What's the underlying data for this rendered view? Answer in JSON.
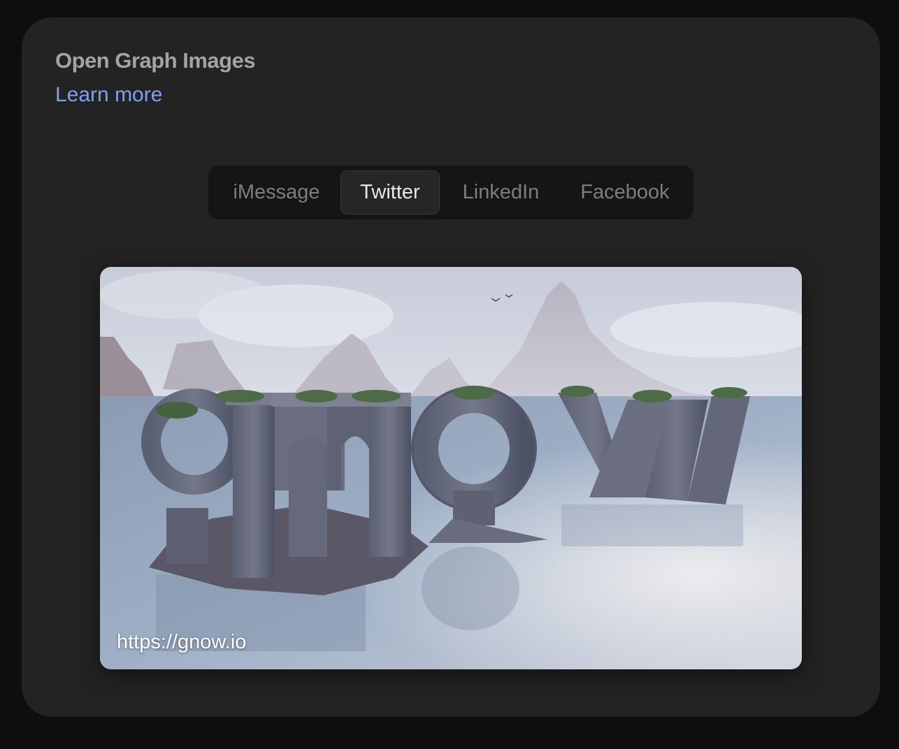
{
  "section": {
    "title": "Open Graph Images",
    "learn_more": "Learn more"
  },
  "tabs": [
    {
      "label": "iMessage",
      "active": false
    },
    {
      "label": "Twitter",
      "active": true
    },
    {
      "label": "LinkedIn",
      "active": false
    },
    {
      "label": "Facebook",
      "active": false
    }
  ],
  "preview": {
    "url": "https://gnow.io",
    "image_wordmark": "gnow"
  },
  "colors": {
    "page_background": "#0e0e0e",
    "card_background": "#232323",
    "link": "#7ea0f2",
    "title": "#a3a3a3"
  }
}
